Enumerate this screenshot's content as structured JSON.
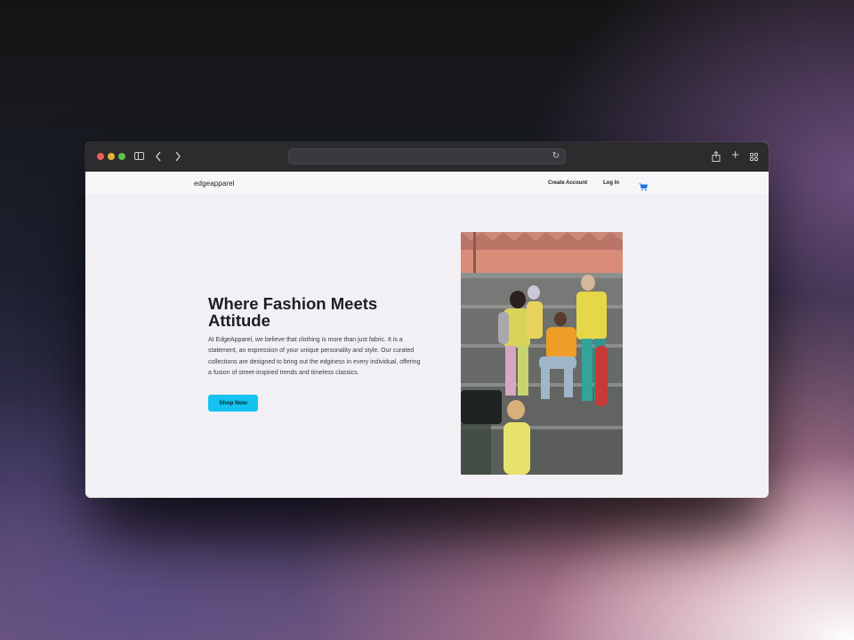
{
  "browser": {
    "address_url": "",
    "icons": [
      "close-dot",
      "minimize-dot",
      "zoom-dot",
      "sidebar-icon",
      "back-icon",
      "forward-icon",
      "reload-icon",
      "share-icon",
      "new-tab-icon",
      "tab-overview-icon"
    ]
  },
  "site": {
    "brand": "edgeapparel",
    "nav": {
      "create_account": "Create Account",
      "login": "Log In",
      "cart_icon": "cart-icon"
    },
    "hero": {
      "title": "Where Fashion Meets Attitude",
      "description": "At EdgeApparel, we believe that clothing is more than just fabric. It is a statement, an expression of your unique personality and style. Our curated collections are designed to bring out the edginess in every individual, offering a fusion of street-inspired trends and timeless classics.",
      "cta": "Shop Now",
      "image_alt": "Group of young people in colorful streetwear posing on concrete steps"
    }
  },
  "colors": {
    "accent": "#14c3f0",
    "cart": "#1a73e8",
    "page_background": "#f2f0f4"
  }
}
